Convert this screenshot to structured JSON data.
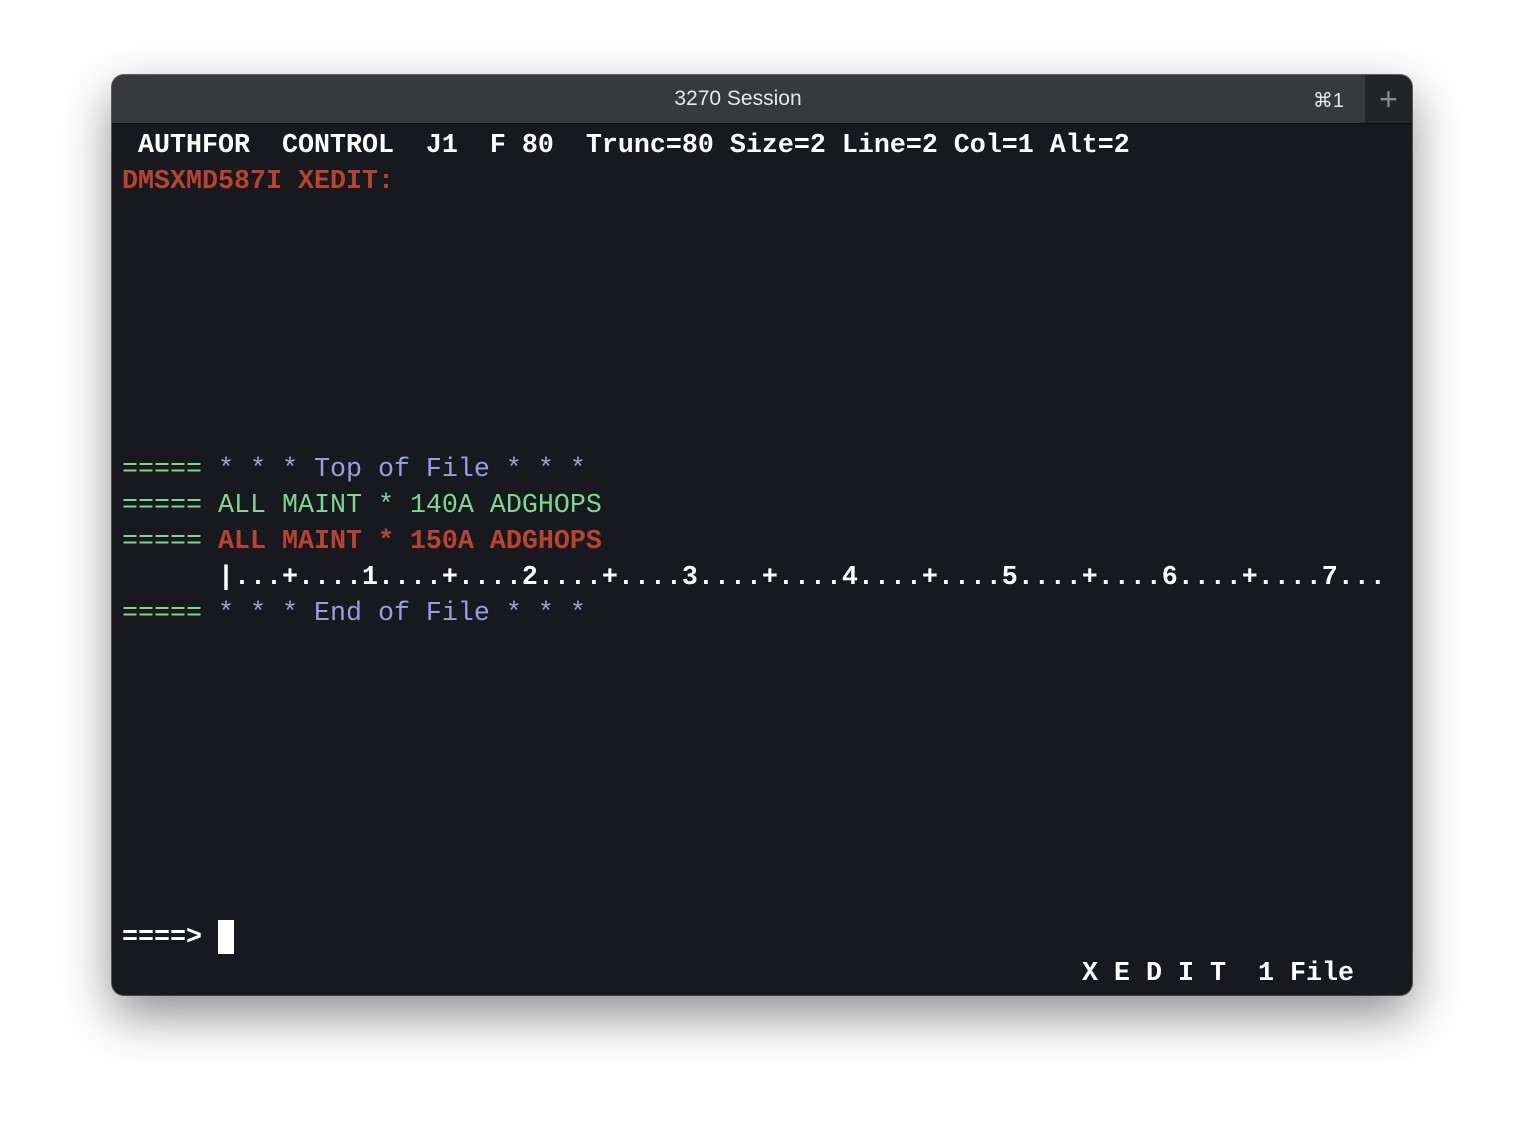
{
  "window": {
    "title": "3270 Session",
    "shortcut": "⌘1",
    "new_tab_icon": "plus-icon"
  },
  "terminal": {
    "header_line": " AUTHFOR  CONTROL  J1  F 80  Trunc=80 Size=2 Line=2 Col=1 Alt=2",
    "message_line": "DMSXMD587I XEDIT:",
    "lines": [
      {
        "prefix": "===== ",
        "text": "* * * Top of File * * *"
      },
      {
        "prefix": "===== ",
        "text": "ALL MAINT * 140A ADGHOPS"
      },
      {
        "prefix": "===== ",
        "text": "ALL MAINT * 150A ADGHOPS"
      },
      {
        "prefix": "      ",
        "text": "|...+....1....+....2....+....3....+....4....+....5....+....6....+....7..."
      },
      {
        "prefix": "===== ",
        "text": "* * * End of File * * *"
      }
    ],
    "command_prompt": "====> ",
    "command_value": "",
    "status_line": "X E D I T  1 File"
  },
  "colors": {
    "background": "#17191e",
    "titlebar": "#38393d",
    "text": "#ffffff",
    "red": "#b8442f",
    "green": "#7dd88a",
    "lavender": "#9a9de0"
  }
}
